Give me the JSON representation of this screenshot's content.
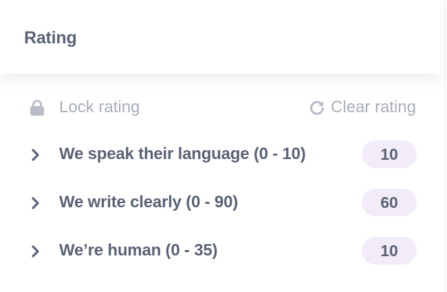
{
  "header": {
    "title": "Rating"
  },
  "toolbar": {
    "lock_label": "Lock rating",
    "clear_label": "Clear rating"
  },
  "items": [
    {
      "label": "We speak their language (0 - 10)",
      "score": "10"
    },
    {
      "label": "We write clearly (0 - 90)",
      "score": "60"
    },
    {
      "label": "We’re human (0 - 35)",
      "score": "10"
    }
  ],
  "colors": {
    "text": "#5a6276",
    "muted": "#a9aeb9",
    "badge_bg": "#f1ecf7"
  },
  "icons": {
    "lock": "lock-icon",
    "clear": "refresh-icon",
    "expand": "chevron-right-icon"
  }
}
